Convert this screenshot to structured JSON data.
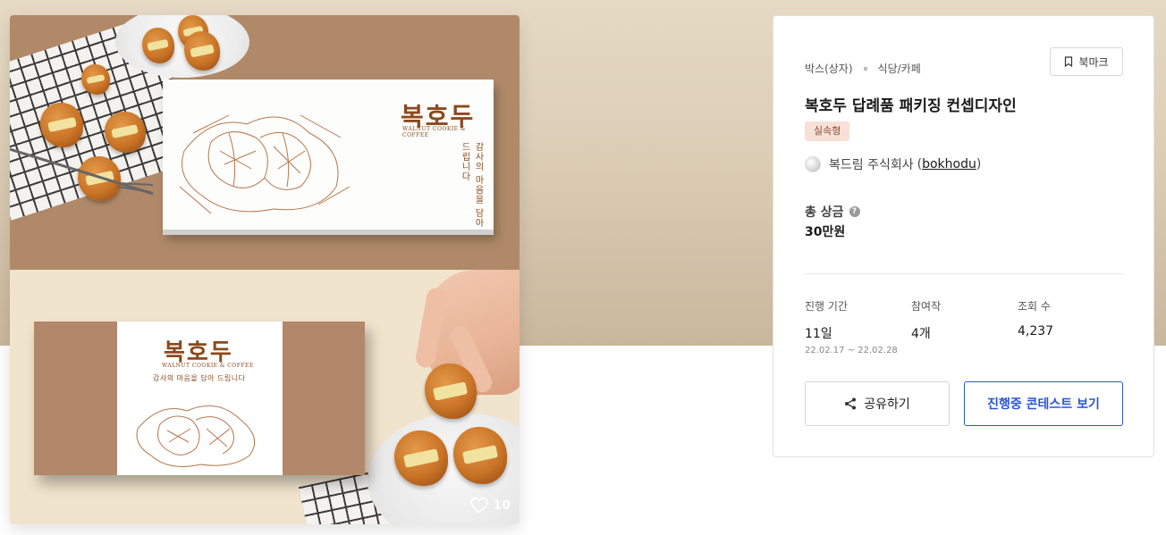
{
  "gallery": {
    "brand_name": "복호두",
    "brand_sub": "WALNUT COOKIE & COFFEE",
    "box_vertical_text": "감사의 마음을 담아 드립니다",
    "box_tagline": "감사의 마음을 담아 드립니다",
    "like_count": "10"
  },
  "contest": {
    "category_primary": "박스(상자)",
    "category_secondary": "식당/카페",
    "bookmark_label": "북마크",
    "title": "복호두 답례품 패키징 컨셉디자인",
    "type_badge": "실속형",
    "host_name": "복드림 주식회사",
    "host_id_open": "(",
    "host_id": "bokhodu",
    "host_id_close": ")",
    "prize_label": "총 상금",
    "prize_value": "30만원",
    "duration_label": "진행 기간",
    "duration_value": "11일",
    "duration_range": "22.02.17 ~ 22.02.28",
    "entries_label": "참여작",
    "entries_value": "4개",
    "views_label": "조회 수",
    "views_value": "4,237",
    "share_label": "공유하기",
    "primary_button_label": "진행중 콘테스트 보기"
  },
  "colors": {
    "accent": "#2b55d8",
    "badge_bg": "#f8e0d6",
    "brand_brown": "#8a4a1e"
  }
}
